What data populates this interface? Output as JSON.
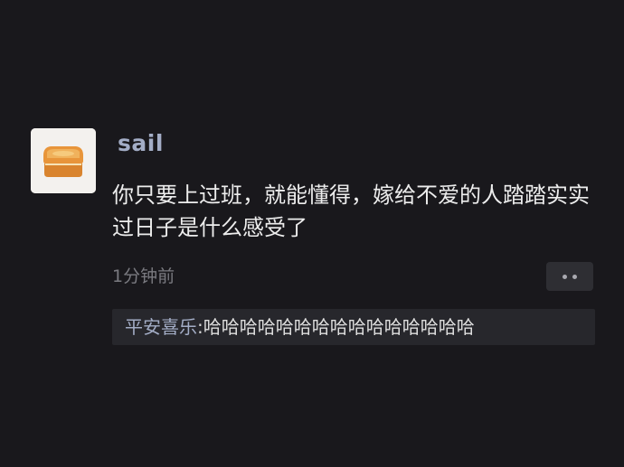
{
  "comment": {
    "username": "sail",
    "avatar_icon": "toast-icon",
    "text": "你只要上过班，就能懂得，嫁给不爱的人踏踏实实过日子是什么感受了",
    "timestamp": "1分钟前",
    "more_icon": "more-dots-icon"
  },
  "reply": {
    "author": "平安喜乐",
    "separator": ": ",
    "text": "哈哈哈哈哈哈哈哈哈哈哈哈哈哈哈"
  },
  "colors": {
    "background": "#19181c",
    "username": "#a3adc6",
    "text": "#ededed",
    "timestamp": "#7a7a80",
    "reply_bg": "#27272c"
  }
}
